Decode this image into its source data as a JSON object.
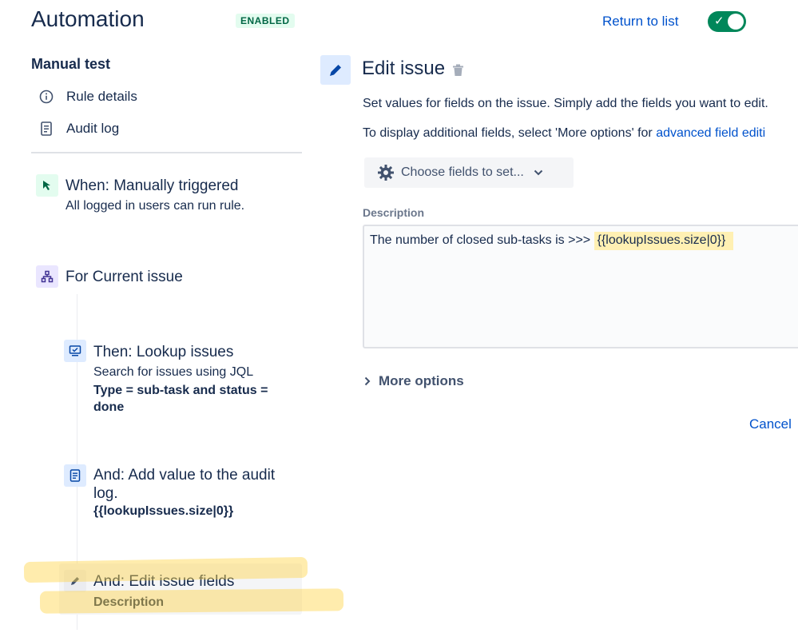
{
  "header": {
    "title": "Automation",
    "badge": "ENABLED",
    "return_link": "Return to list",
    "toggle_state": "on"
  },
  "sidebar": {
    "section_title": "Manual test",
    "nav": [
      {
        "label": "Rule details",
        "icon": "info-icon"
      },
      {
        "label": "Audit log",
        "icon": "document-icon"
      }
    ],
    "steps": [
      {
        "title": "When: Manually triggered",
        "subtitle": "All logged in users can run rule.",
        "icon": "cursor-icon",
        "color": "#e3fcef"
      },
      {
        "title": "For Current issue",
        "icon": "branch-icon",
        "color": "#eae6ff"
      },
      {
        "title": "Then: Lookup issues",
        "subtitle": "Search for issues using JQL",
        "detail": "Type = sub-task and status = done",
        "icon": "monitor-icon",
        "color": "#deebff"
      },
      {
        "title": "And: Add value to the audit log.",
        "detail": "{{lookupIssues.size|0}}",
        "icon": "document-icon",
        "color": "#deebff"
      },
      {
        "title": "And: Edit issue fields",
        "detail": "Description",
        "icon": "pencil-icon",
        "color": "#ebecf0"
      }
    ]
  },
  "editor": {
    "title": "Edit issue",
    "description_line1": "Set values for fields on the issue. Simply add the fields you want to edit.",
    "description_line2_prefix": "To display additional fields, select 'More options' for ",
    "description_line2_link": "advanced field editi",
    "choose_fields_label": "Choose fields to set...",
    "field_label": "Description",
    "field_value_prefix": "The number of closed sub-tasks is >>> ",
    "field_value_smart": "{{lookupIssues.size|0}}",
    "more_options": "More options",
    "cancel": "Cancel"
  },
  "colors": {
    "accent": "#0052cc",
    "toggle_on": "#00875a",
    "highlight": "#fff0b3",
    "marker": "#ffd54a"
  }
}
